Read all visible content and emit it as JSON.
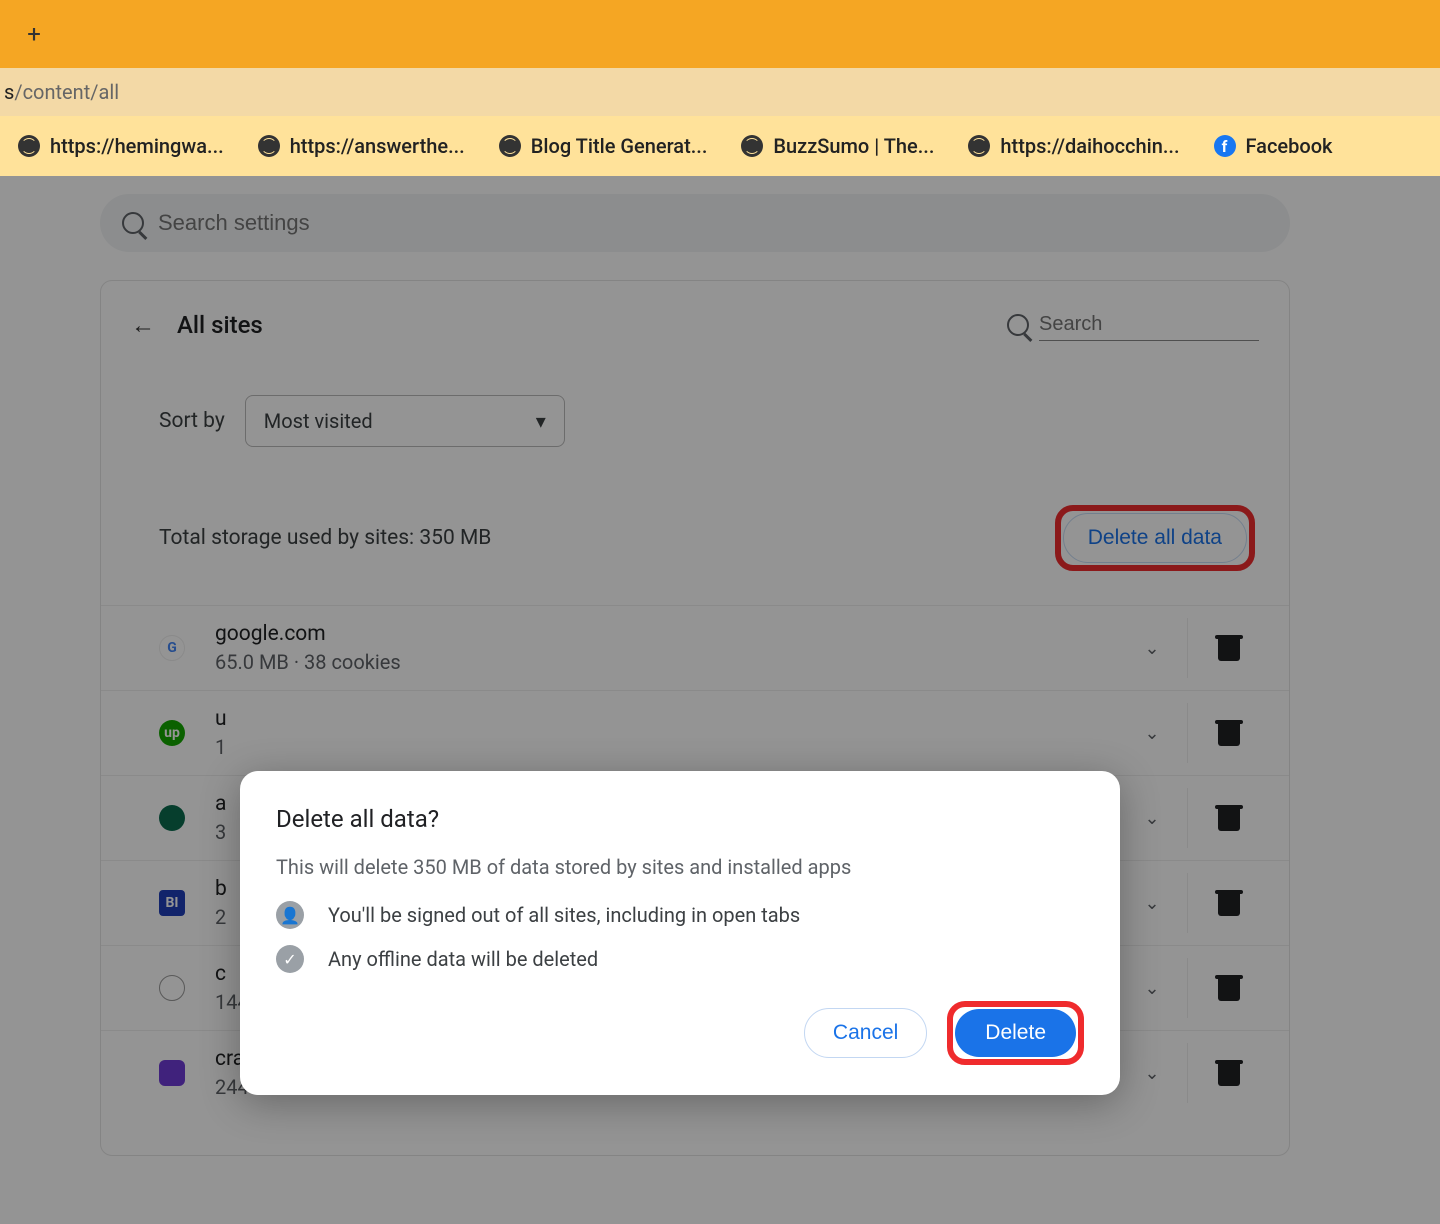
{
  "tabstrip": {
    "new_tab": "+"
  },
  "address_bar": {
    "path_prefix": "s",
    "path_rest": "/content/all"
  },
  "bookmarks": [
    {
      "label": "https://hemingwa...",
      "icon": "globe"
    },
    {
      "label": "https://answerthe...",
      "icon": "globe"
    },
    {
      "label": "Blog Title Generat...",
      "icon": "globe"
    },
    {
      "label": "BuzzSumo | The...",
      "icon": "globe"
    },
    {
      "label": "https://daihocchin...",
      "icon": "globe"
    },
    {
      "label": "Facebook",
      "icon": "fb"
    }
  ],
  "search_settings_placeholder": "Search settings",
  "panel": {
    "title": "All sites",
    "search_placeholder": "Search",
    "sort_label": "Sort by",
    "sort_value": "Most visited",
    "storage_text": "Total storage used by sites: 350 MB",
    "delete_all_label": "Delete all data"
  },
  "sites": [
    {
      "domain": "google.com",
      "meta": "65.0 MB · 38 cookies",
      "favicon": "G",
      "color": "linear-gradient(135deg,#4285f4,#ea4335,#fbbc05,#34a853)"
    },
    {
      "domain": "u",
      "meta": "1",
      "favicon": "up",
      "color": "#14a800"
    },
    {
      "domain": "a",
      "meta": "3",
      "favicon": "",
      "color": "#0b6b4f"
    },
    {
      "domain": "b",
      "meta": "2",
      "favicon": "BI",
      "color": "#1f3fb8"
    },
    {
      "domain": "c",
      "meta": "144 KB",
      "favicon": "",
      "color": "#777"
    },
    {
      "domain": "crazygames.com",
      "meta": "244 KB",
      "favicon": "",
      "color": "#6f3bd6"
    }
  ],
  "dialog": {
    "title": "Delete all data?",
    "desc": "This will delete 350 MB of data stored by sites and installed apps",
    "bullet1": "You'll be signed out of all sites, including in open tabs",
    "bullet2": "Any offline data will be deleted",
    "cancel": "Cancel",
    "delete": "Delete"
  }
}
